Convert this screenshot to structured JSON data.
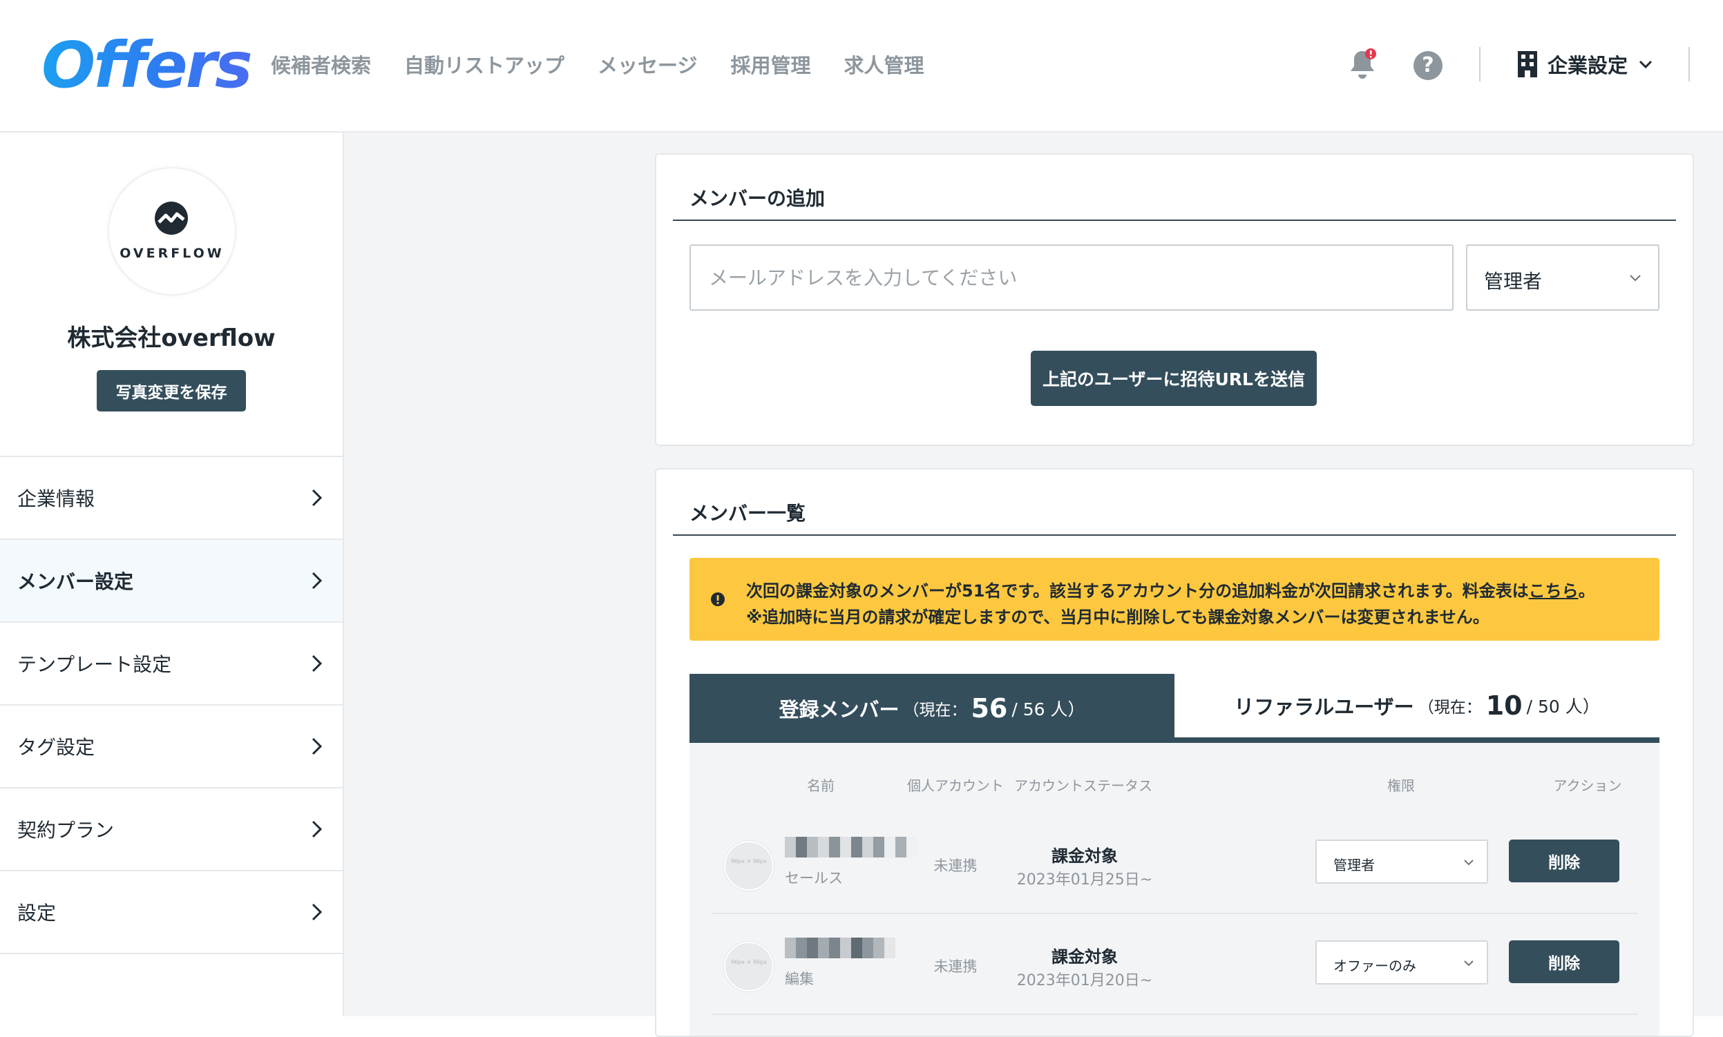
{
  "header": {
    "logo": "Offers",
    "nav": [
      "候補者検索",
      "自動リストアップ",
      "メッセージ",
      "採用管理",
      "求人管理"
    ],
    "company_menu": "企業設定",
    "help_icon": "?"
  },
  "sidebar": {
    "logo_word": "OVERFLOW",
    "company_name": "株式会社overflow",
    "save_photo_button": "写真変更を保存",
    "items": [
      {
        "label": "企業情報"
      },
      {
        "label": "メンバー設定"
      },
      {
        "label": "テンプレート設定"
      },
      {
        "label": "タグ設定"
      },
      {
        "label": "契約プラン"
      },
      {
        "label": "設定"
      }
    ]
  },
  "add_member": {
    "title": "メンバーの追加",
    "email_placeholder": "メールアドレスを入力してください",
    "role": "管理者",
    "invite_button": "上記のユーザーに招待URLを送信"
  },
  "member_list": {
    "title": "メンバー一覧",
    "notice": {
      "line1": "次回の課金対象のメンバーが51名です。該当するアカウント分の追加料金が次回請求されます。料金表は",
      "link": "こちら",
      "line1_end": "。",
      "line2": "※追加時に当月の請求が確定しますので、当月中に削除しても課金対象メンバーは変更されません。"
    },
    "tabs": [
      {
        "label": "登録メンバー",
        "current_prefix": "（現在：",
        "current": "56",
        "total": "/ 56 人）"
      },
      {
        "label": "リファラルユーザー",
        "current_prefix": "（現在：",
        "current": "10",
        "total": "/ 50 人）"
      }
    ],
    "columns": [
      "名前",
      "個人アカウント",
      "アカウントステータス",
      "権限",
      "アクション"
    ],
    "avatar_placeholder": "96px × 96px",
    "rows": [
      {
        "department": "セールス",
        "personal_account": "未連携",
        "status": "課金対象",
        "date": "2023年01月25日~",
        "permission": "管理者",
        "action": "削除"
      },
      {
        "department": "編集",
        "personal_account": "未連携",
        "status": "課金対象",
        "date": "2023年01月20日~",
        "permission": "オファーのみ",
        "action": "削除"
      }
    ]
  },
  "colors": {
    "primary": "#344e5c",
    "notice": "#fdc83f",
    "badge": "#e5384f",
    "logo": "#2d7df0"
  }
}
